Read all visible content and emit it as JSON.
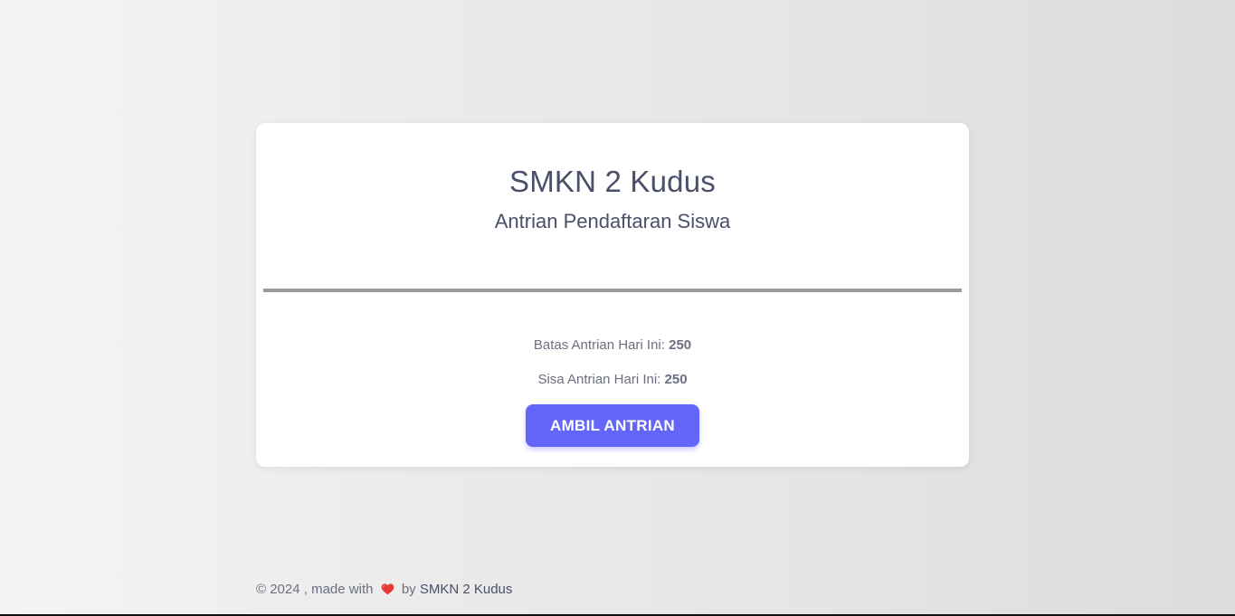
{
  "card": {
    "title": "SMKN 2 Kudus",
    "subtitle": "Antrian Pendaftaran Siswa",
    "limit_label": "Batas Antrian Hari Ini: ",
    "limit_value": "250",
    "remaining_label": "Sisa Antrian Hari Ini: ",
    "remaining_value": "250",
    "button_label": "AMBIL ANTRIAN"
  },
  "footer": {
    "prefix": "© 2024 , made with",
    "icon": "heart-icon",
    "by": "by",
    "brand": "SMKN 2 Kudus"
  },
  "colors": {
    "accent": "#6366f8",
    "heart": "#e53935"
  }
}
